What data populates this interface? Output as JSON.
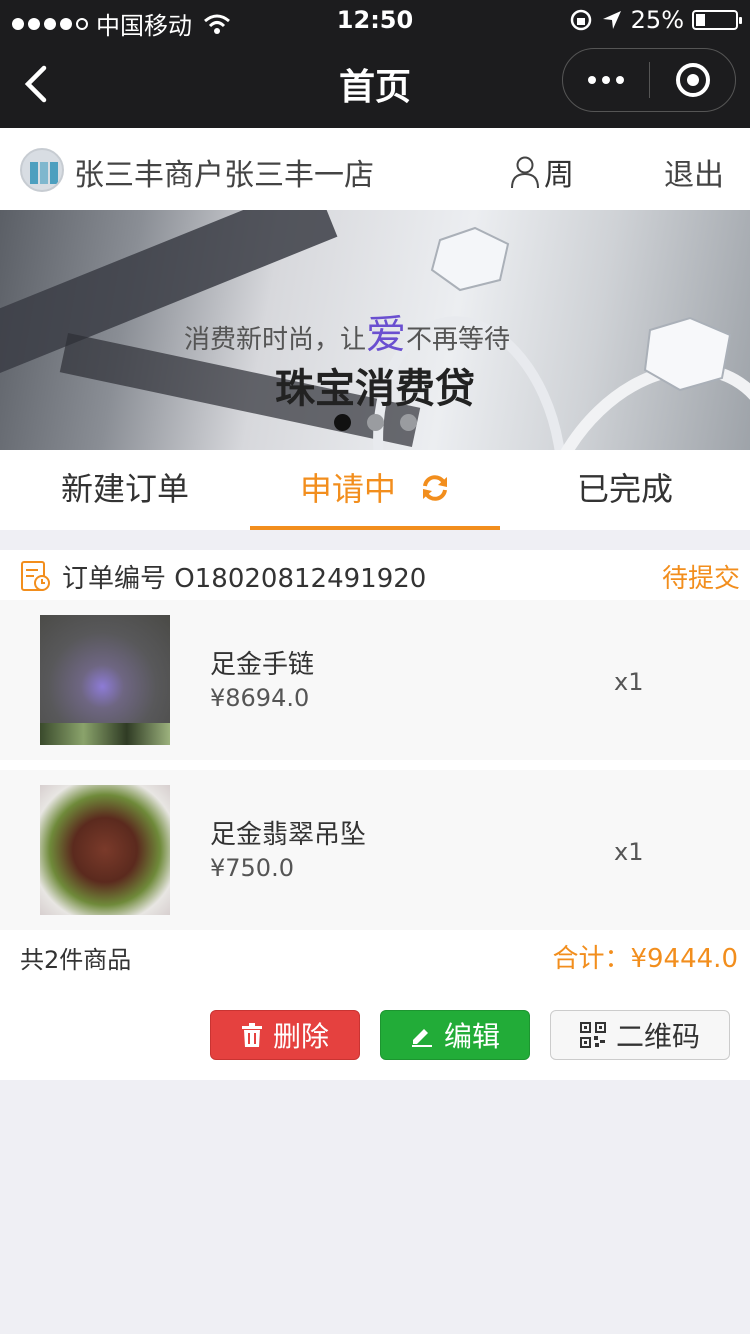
{
  "status_bar": {
    "carrier": "中国移动",
    "time": "12:50",
    "battery": "25%",
    "battery_level": 0.25
  },
  "nav": {
    "title": "首页",
    "back_icon": "chevron-left-icon",
    "more_icon": "more-dots-icon",
    "close_icon": "target-close-icon"
  },
  "merchant": {
    "name": "张三丰商户张三丰一店",
    "user": "周",
    "logout": "退出"
  },
  "banner": {
    "slogan_pre": "消费新时尚，让",
    "slogan_love": "爱",
    "slogan_post": "不再等待",
    "headline": "珠宝消费贷",
    "slides": 3,
    "active_slide": 1
  },
  "tabs": [
    {
      "label": "新建订单",
      "active": false
    },
    {
      "label": "申请中",
      "active": true
    },
    {
      "label": "已完成",
      "active": false
    }
  ],
  "order": {
    "number_label": "订单编号 O18020812491920",
    "status": "待提交",
    "items": [
      {
        "name": "足金手链",
        "price": "¥8694.0",
        "qty": "x1"
      },
      {
        "name": "足金翡翠吊坠",
        "price": "¥750.0",
        "qty": "x1"
      }
    ],
    "count_text": "共2件商品",
    "total_text": "合计：¥9444.0"
  },
  "actions": {
    "delete": "删除",
    "edit": "编辑",
    "qrcode": "二维码"
  },
  "colors": {
    "accent": "#f28e1d",
    "delete": "#e5413f",
    "edit": "#22ac38",
    "nav_bg": "#1c1c1e"
  }
}
